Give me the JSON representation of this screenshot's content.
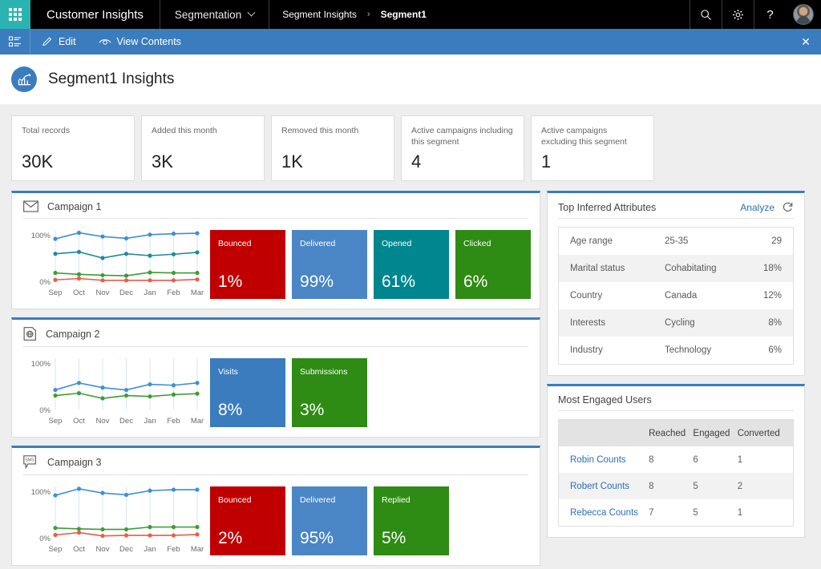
{
  "topnav": {
    "waffle_icon": "waffle-grid-icon",
    "app_title": "Customer Insights",
    "module": "Segmentation",
    "module_chevron": "chevron-down-icon",
    "breadcrumb": [
      {
        "label": "Segment Insights",
        "active": false
      },
      {
        "label": "Segment1",
        "active": true
      }
    ],
    "breadcrumb_separator": "›",
    "icons": [
      "search-icon",
      "gear-icon",
      "help-icon",
      "avatar"
    ]
  },
  "commandbar": {
    "list_icon": "list-view-icon",
    "edit": {
      "label": "Edit",
      "icon": "pencil-icon"
    },
    "view_contents": {
      "label": "View Contents",
      "icon": "eye-icon"
    },
    "close_label": "✕"
  },
  "pagehead": {
    "badge_icon": "chart-trend-icon",
    "title": "Segment1 Insights"
  },
  "kpis": [
    {
      "label": "Total records",
      "value": "30K"
    },
    {
      "label": "Added this month",
      "value": "3K"
    },
    {
      "label": "Removed this month",
      "value": "1K"
    },
    {
      "label": "Active campaigns including this segment",
      "value": "4"
    },
    {
      "label": "Active campaigns excluding this segment",
      "value": "1"
    }
  ],
  "colors": {
    "accent_blue": "#3a7cbe",
    "red": "#c00000",
    "blue": "#4a86c5",
    "teal": "#00868e",
    "green": "#2e8b13",
    "nav_black": "#000000",
    "waffle_teal": "#2bb3b1",
    "link_blue": "#2b6fb5"
  },
  "campaigns": [
    {
      "icon": "email-envelope-icon",
      "title": "Campaign 1",
      "tiles": [
        {
          "label": "Bounced",
          "value": "1%",
          "color": "#c00000"
        },
        {
          "label": "Delivered",
          "value": "99%",
          "color": "#4a86c5"
        },
        {
          "label": "Opened",
          "value": "61%",
          "color": "#00868e"
        },
        {
          "label": "Clicked",
          "value": "6%",
          "color": "#2e8b13"
        }
      ]
    },
    {
      "icon": "web-page-icon",
      "title": "Campaign 2",
      "tiles": [
        {
          "label": "Visits",
          "value": "8%",
          "color": "#3a7cbe"
        },
        {
          "label": "Submissions",
          "value": "3%",
          "color": "#2e8b13"
        }
      ]
    },
    {
      "icon": "sms-bubble-icon",
      "title": "Campaign 3",
      "tiles": [
        {
          "label": "Bounced",
          "value": "2%",
          "color": "#c00000"
        },
        {
          "label": "Delivered",
          "value": "95%",
          "color": "#4a86c5"
        },
        {
          "label": "Replied",
          "value": "5%",
          "color": "#2e8b13"
        }
      ]
    }
  ],
  "chart_data": [
    {
      "type": "line",
      "title": "Campaign 1",
      "x": [
        "Sep",
        "Oct",
        "Nov",
        "Dec",
        "Jan",
        "Feb",
        "Mar"
      ],
      "xlabel": "",
      "ylabel": "",
      "ylim": [
        0,
        110
      ],
      "ytick_labels": [
        "0%",
        "100%"
      ],
      "ytick_values": [
        0,
        100
      ],
      "grid": "vertical",
      "legend": "none",
      "series": [
        {
          "name": "Delivered",
          "color": "#3d8fd4",
          "values": [
            91,
            104,
            96,
            92,
            100,
            102,
            103
          ]
        },
        {
          "name": "Opened",
          "color": "#1f8a9c",
          "values": [
            59,
            63,
            50,
            59,
            55,
            58,
            62
          ]
        },
        {
          "name": "Clicked",
          "color": "#3e9b36",
          "values": [
            18,
            15,
            13,
            12,
            19,
            18,
            18
          ]
        },
        {
          "name": "Bounced",
          "color": "#ea5b4a",
          "values": [
            3,
            6,
            2,
            2,
            2,
            2,
            4
          ]
        }
      ]
    },
    {
      "type": "line",
      "title": "Campaign 2",
      "x": [
        "Sep",
        "Oct",
        "Nov",
        "Dec",
        "Jan",
        "Feb",
        "Mar"
      ],
      "xlabel": "",
      "ylabel": "",
      "ylim": [
        0,
        110
      ],
      "ytick_labels": [
        "0%",
        "100%"
      ],
      "ytick_values": [
        0,
        100
      ],
      "grid": "vertical",
      "legend": "none",
      "series": [
        {
          "name": "Visits",
          "color": "#3d8fd4",
          "values": [
            42,
            57,
            47,
            42,
            54,
            52,
            57
          ]
        },
        {
          "name": "Submissions",
          "color": "#3e9b36",
          "values": [
            30,
            35,
            24,
            30,
            28,
            32,
            34
          ]
        }
      ]
    },
    {
      "type": "line",
      "title": "Campaign 3",
      "x": [
        "Sep",
        "Oct",
        "Nov",
        "Dec",
        "Jan",
        "Feb",
        "Mar"
      ],
      "xlabel": "",
      "ylabel": "",
      "ylim": [
        0,
        110
      ],
      "ytick_labels": [
        "0%",
        "100%"
      ],
      "ytick_values": [
        0,
        100
      ],
      "grid": "vertical",
      "legend": "none",
      "series": [
        {
          "name": "Delivered",
          "color": "#3d8fd4",
          "values": [
            91,
            105,
            96,
            92,
            101,
            103,
            103
          ]
        },
        {
          "name": "Replied",
          "color": "#3e9b36",
          "values": [
            21,
            19,
            18,
            18,
            23,
            23,
            23
          ]
        },
        {
          "name": "Bounced",
          "color": "#ea5b4a",
          "values": [
            6,
            11,
            4,
            5,
            5,
            5,
            7
          ]
        }
      ]
    }
  ],
  "inferred_attributes": {
    "title": "Top Inferred Attributes",
    "analyze_label": "Analyze",
    "refresh_icon": "refresh-icon",
    "rows": [
      {
        "name": "Age range",
        "value": "25-35",
        "pct": "29"
      },
      {
        "name": "Marital status",
        "value": "Cohabitating",
        "pct": "18%"
      },
      {
        "name": "Country",
        "value": "Canada",
        "pct": "12%"
      },
      {
        "name": "Interests",
        "value": "Cycling",
        "pct": "8%"
      },
      {
        "name": "Industry",
        "value": "Technology",
        "pct": "6%"
      }
    ]
  },
  "engaged_users": {
    "title": "Most Engaged Users",
    "columns": [
      "",
      "Reached",
      "Engaged",
      "Converted"
    ],
    "rows": [
      {
        "name": "Robin Counts",
        "reached": "8",
        "engaged": "6",
        "converted": "1"
      },
      {
        "name": "Robert Counts",
        "reached": "8",
        "engaged": "5",
        "converted": "2"
      },
      {
        "name": "Rebecca Counts",
        "reached": "7",
        "engaged": "5",
        "converted": "1"
      }
    ]
  }
}
